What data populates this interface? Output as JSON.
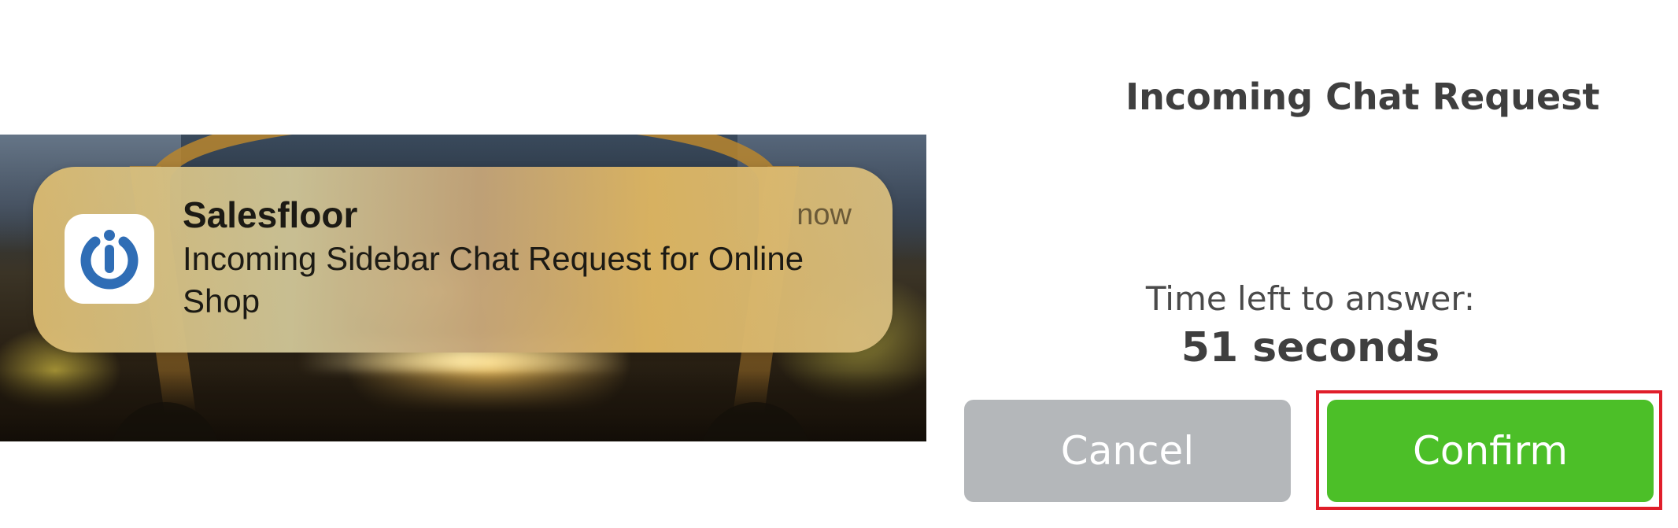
{
  "notification": {
    "app_name": "Salesfloor",
    "time": "now",
    "body": "Incoming Sidebar Chat Request for Online Shop",
    "icon": "salesfloor-power-icon"
  },
  "dialog": {
    "title": "Incoming Chat Request",
    "time_label": "Time left to answer:",
    "time_value": "51 seconds",
    "cancel_label": "Cancel",
    "confirm_label": "Confirm"
  },
  "colors": {
    "confirm_button": "#4cbf28",
    "cancel_button": "#b4b7ba",
    "highlight_border": "#e01e2a",
    "app_icon_blue": "#2f6db5"
  }
}
